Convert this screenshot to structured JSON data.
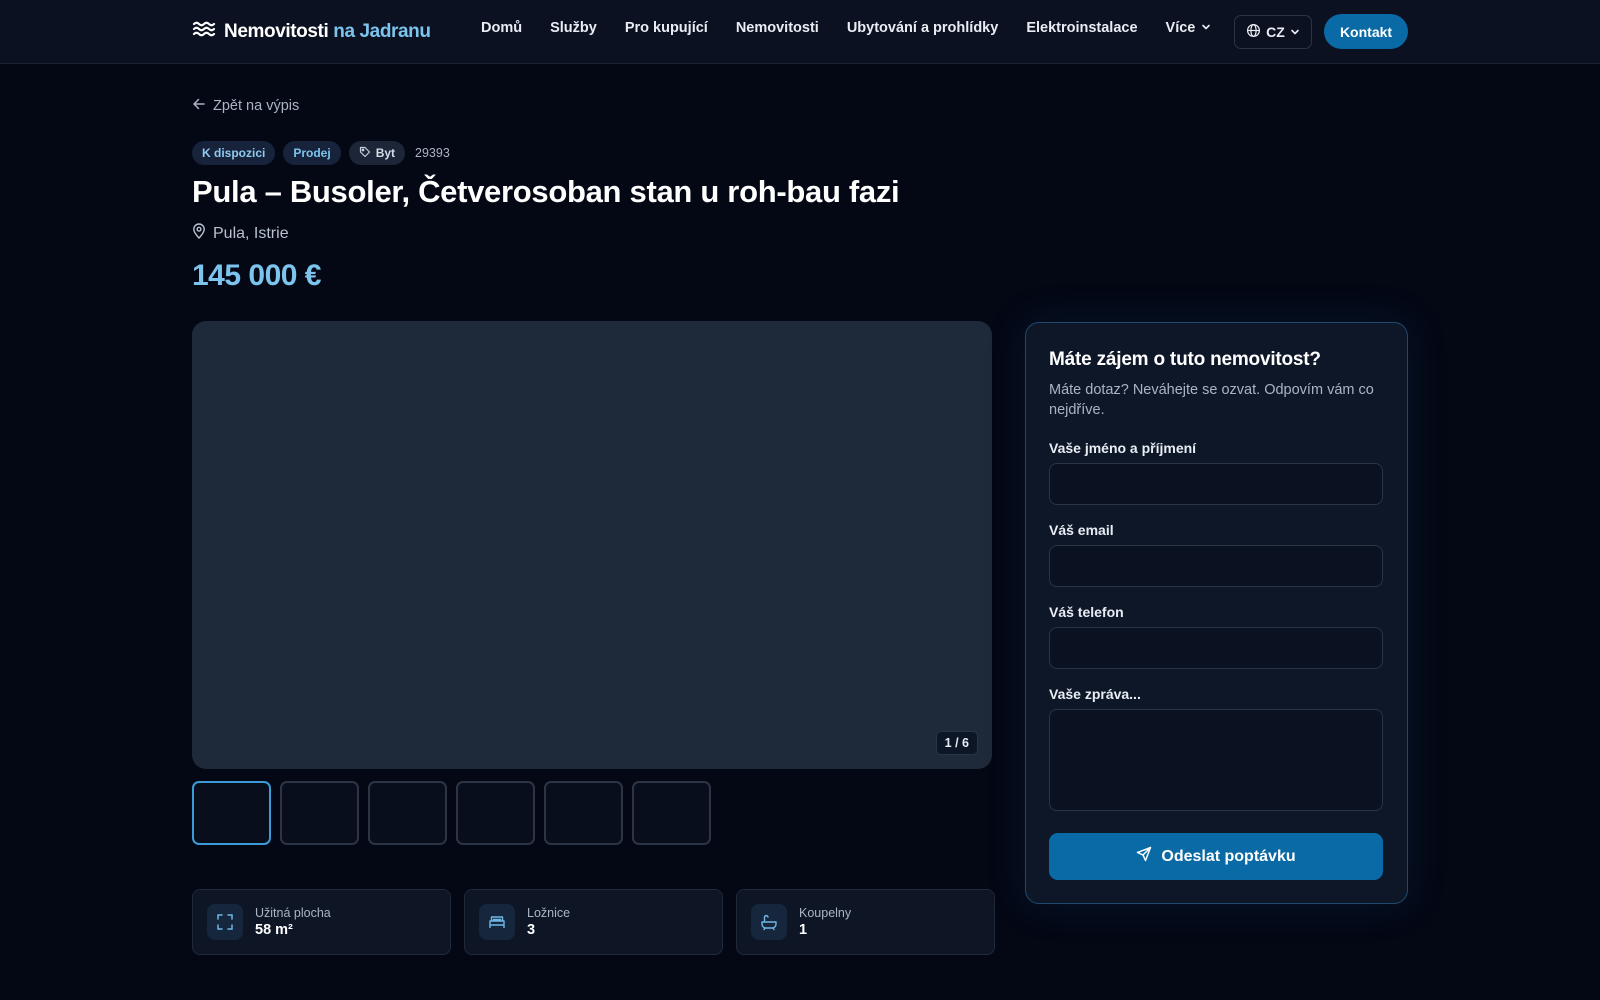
{
  "header": {
    "logo_part1": "Nemovitosti",
    "logo_part2": "na Jadranu",
    "nav": [
      {
        "label": "Domů"
      },
      {
        "label": "Služby"
      },
      {
        "label": "Pro kupující"
      },
      {
        "label": "Nemovitosti"
      },
      {
        "label": "Ubytování a prohlídky"
      },
      {
        "label": "Elektroinstalace"
      },
      {
        "label": "Více"
      }
    ],
    "language": "CZ",
    "contact_label": "Kontakt"
  },
  "listing": {
    "back_label": "Zpět na výpis",
    "badges": {
      "availability": "K dispozici",
      "deal": "Prodej",
      "type": "Byt"
    },
    "ref_number": "29393",
    "title": "Pula – Busoler, Četverosoban stan u roh-bau fazi",
    "location": "Pula, Istrie",
    "price": "145 000 €",
    "gallery_counter": "1 / 6",
    "thumbnail_count": 6,
    "stats": [
      {
        "label": "Užitná plocha",
        "value": "58 m²",
        "icon": "area-icon"
      },
      {
        "label": "Ložnice",
        "value": "3",
        "icon": "bed-icon"
      },
      {
        "label": "Koupelny",
        "value": "1",
        "icon": "bath-icon"
      }
    ]
  },
  "form": {
    "title": "Máte zájem o tuto nemovitost?",
    "subtitle": "Máte dotaz? Neváhejte se ozvat. Odpovím vám co nejdříve.",
    "name_label": "Vaše jméno a příjmení",
    "email_label": "Váš email",
    "phone_label": "Váš telefon",
    "message_label": "Vaše zpráva...",
    "submit_label": "Odeslat poptávku"
  },
  "colors": {
    "accent": "#7cc4ee",
    "button": "#0a6aa6",
    "background": "#040815"
  }
}
